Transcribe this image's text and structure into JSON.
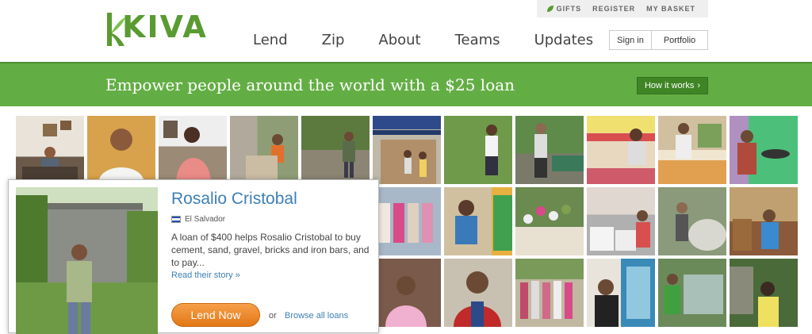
{
  "header": {
    "logo_text": "KIVA",
    "utility": {
      "gifts": "GIFTS",
      "register": "REGISTER",
      "basket": "MY BASKET"
    },
    "nav": [
      "Lend",
      "Zip",
      "About",
      "Teams",
      "Updates"
    ],
    "account": {
      "signin": "Sign in",
      "portfolio": "Portfolio"
    }
  },
  "banner": {
    "text": "Empower people around the world with a $25 loan",
    "how_it_works": "How it works",
    "how_arrow": "›"
  },
  "colors": {
    "brand_green": "#5a9b31",
    "banner_green": "#63ae44",
    "link_blue": "#3d7fb6",
    "lend_orange": "#e27715"
  },
  "featured": {
    "name": "Rosalio Cristobal",
    "country": "El Salvador",
    "description": "A loan of $400 helps Rosalio Cristobal to buy cement, sand, gravel, bricks and iron bars, and to pay...",
    "read_story": "Read their story »",
    "lend_button": "Lend Now",
    "or": "or",
    "browse": "Browse all loans"
  }
}
